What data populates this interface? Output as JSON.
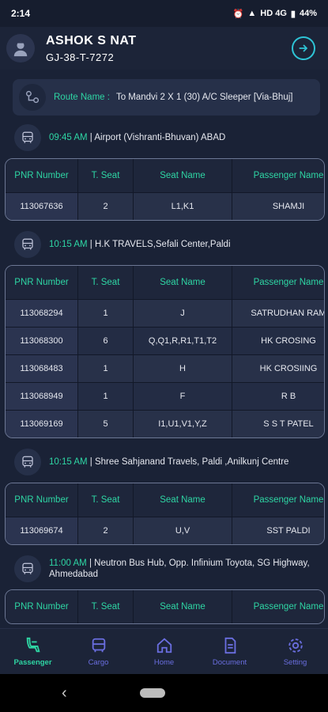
{
  "status": {
    "time": "2:14",
    "network": "HD 4G",
    "battery": "44%"
  },
  "header": {
    "name": "ASHOK S NAT",
    "vehicle": "GJ-38-T-7272"
  },
  "route": {
    "label": "Route Name :",
    "value": "To Mandvi 2 X 1 (30) A/C Sleeper [Via-Bhuj]"
  },
  "table_headers": {
    "pnr": "PNR Number",
    "seat": "T. Seat",
    "seat_name": "Seat Name",
    "passenger": "Passenger Name"
  },
  "stops": [
    {
      "time": "09:45 AM",
      "place": "| Airport (Vishranti-Bhuvan) ABAD",
      "rows": [
        {
          "pnr": "113067636",
          "seat": "2",
          "seat_name": "L1,K1",
          "passenger": "SHAMJI"
        }
      ]
    },
    {
      "time": "10:15 AM",
      "place": "| H.K TRAVELS,Sefali Center,Paldi",
      "rows": [
        {
          "pnr": "113068294",
          "seat": "1",
          "seat_name": "J",
          "passenger": "SATRUDHAN RAM"
        },
        {
          "pnr": "113068300",
          "seat": "6",
          "seat_name": "Q,Q1,R,R1,T1,T2",
          "passenger": "HK CROSING"
        },
        {
          "pnr": "113068483",
          "seat": "1",
          "seat_name": "H",
          "passenger": "HK CROSIING"
        },
        {
          "pnr": "113068949",
          "seat": "1",
          "seat_name": "F",
          "passenger": "R  B"
        },
        {
          "pnr": "113069169",
          "seat": "5",
          "seat_name": "I1,U1,V1,Y,Z",
          "passenger": "S  S  T     PATEL"
        }
      ]
    },
    {
      "time": "10:15 AM",
      "place": "| Shree Sahjanand Travels, Paldi ,Anilkunj Centre",
      "rows": [
        {
          "pnr": "113069674",
          "seat": "2",
          "seat_name": "U,V",
          "passenger": "SST PALDI"
        }
      ]
    },
    {
      "time": "11:00 AM",
      "place": "| Neutron Bus Hub, Opp. Infinium Toyota, SG Highway, Ahmedabad",
      "rows": []
    }
  ],
  "nav": [
    {
      "label": "Passenger",
      "icon": "passenger-icon",
      "active": true
    },
    {
      "label": "Cargo",
      "icon": "cargo-icon",
      "active": false
    },
    {
      "label": "Home",
      "icon": "home-icon",
      "active": false
    },
    {
      "label": "Document",
      "icon": "document-icon",
      "active": false
    },
    {
      "label": "Setting",
      "icon": "settings-icon",
      "active": false
    }
  ],
  "colors": {
    "accent": "#2ed6a4",
    "nav": "#6a6ee0",
    "background": "#1a2236"
  }
}
